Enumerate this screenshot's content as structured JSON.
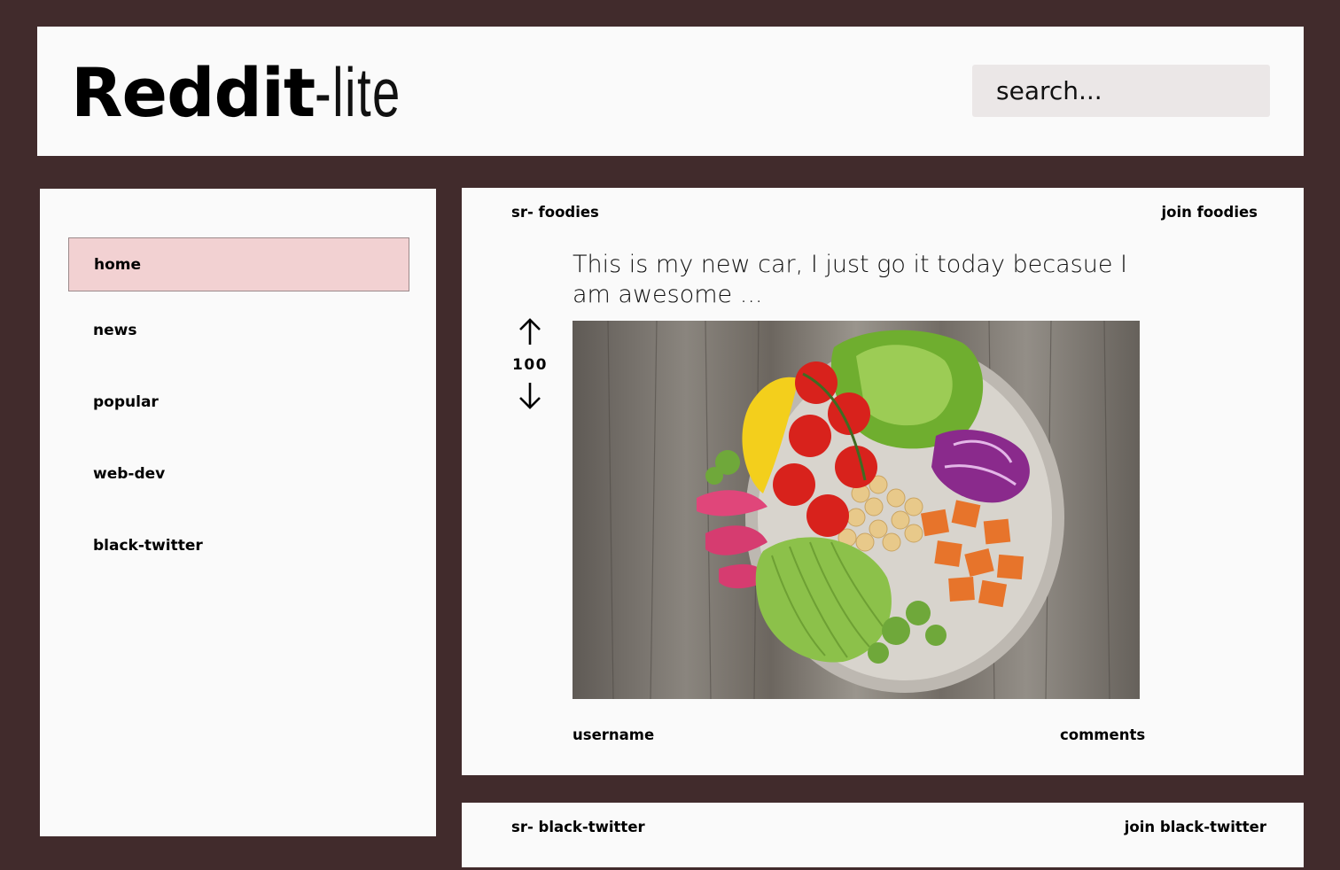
{
  "header": {
    "logo_bold": "Reddit",
    "logo_light": "-lite",
    "search_placeholder": "search..."
  },
  "sidebar": {
    "items": [
      {
        "label": "home",
        "active": true
      },
      {
        "label": "news"
      },
      {
        "label": "popular"
      },
      {
        "label": "web-dev"
      },
      {
        "label": "black-twitter"
      }
    ]
  },
  "posts": [
    {
      "subreddit": "sr- foodies",
      "join_label": "join foodies",
      "title": "This is my new car, I just go it today becasue I am awesome ...",
      "score": "100",
      "image": "salad-bowl-photo",
      "username": "username",
      "comments": "comments"
    },
    {
      "subreddit": "sr- black-twitter",
      "join_label": "join black-twitter"
    }
  ],
  "colors": {
    "background": "#412b2c",
    "panel": "#fafafa",
    "active_nav": "#f2d1d2",
    "search_bg": "#ebe7e7"
  }
}
